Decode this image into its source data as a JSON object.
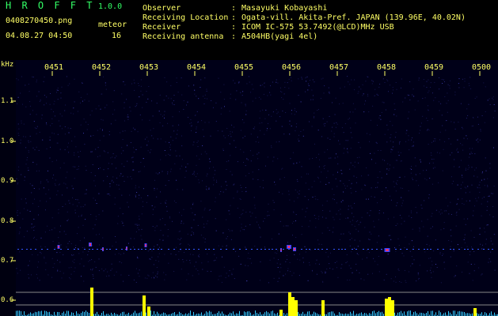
{
  "app": {
    "name": "H R O F F T",
    "version": "1.0.0"
  },
  "file": {
    "name": "0408270450.png",
    "datetime": "04.08.27 04:50"
  },
  "meteor": {
    "label": "meteor",
    "count": "16"
  },
  "info": [
    {
      "label": "Observer",
      "sep": ":",
      "value": "Masayuki Kobayashi"
    },
    {
      "label": "Receiving Location",
      "sep": ":",
      "value": "Ogata-vill. Akita-Pref. JAPAN (139.96E, 40.02N)"
    },
    {
      "label": "Receiver",
      "sep": ":",
      "value": "ICOM IC-575 53.7492(@LCD)MHz USB"
    },
    {
      "label": "Receiving antenna",
      "sep": ":",
      "value": "A504HB(yagi 4el)"
    }
  ],
  "spectrogram": {
    "y_unit": "kHz",
    "y_ticks": [
      "1.1",
      "1.0",
      "0.9",
      "0.8",
      "0.7",
      "0.6"
    ],
    "time_labels": [
      "0451",
      "0452",
      "0453",
      "0454",
      "0455",
      "0456",
      "0457",
      "0458",
      "0459",
      "0500"
    ],
    "colors": {
      "background": "#000018",
      "labels": "#ffff66",
      "meteor_hot": "#ff3366",
      "signal_bar": "#ffff00",
      "noise": "#33ccff"
    }
  }
}
